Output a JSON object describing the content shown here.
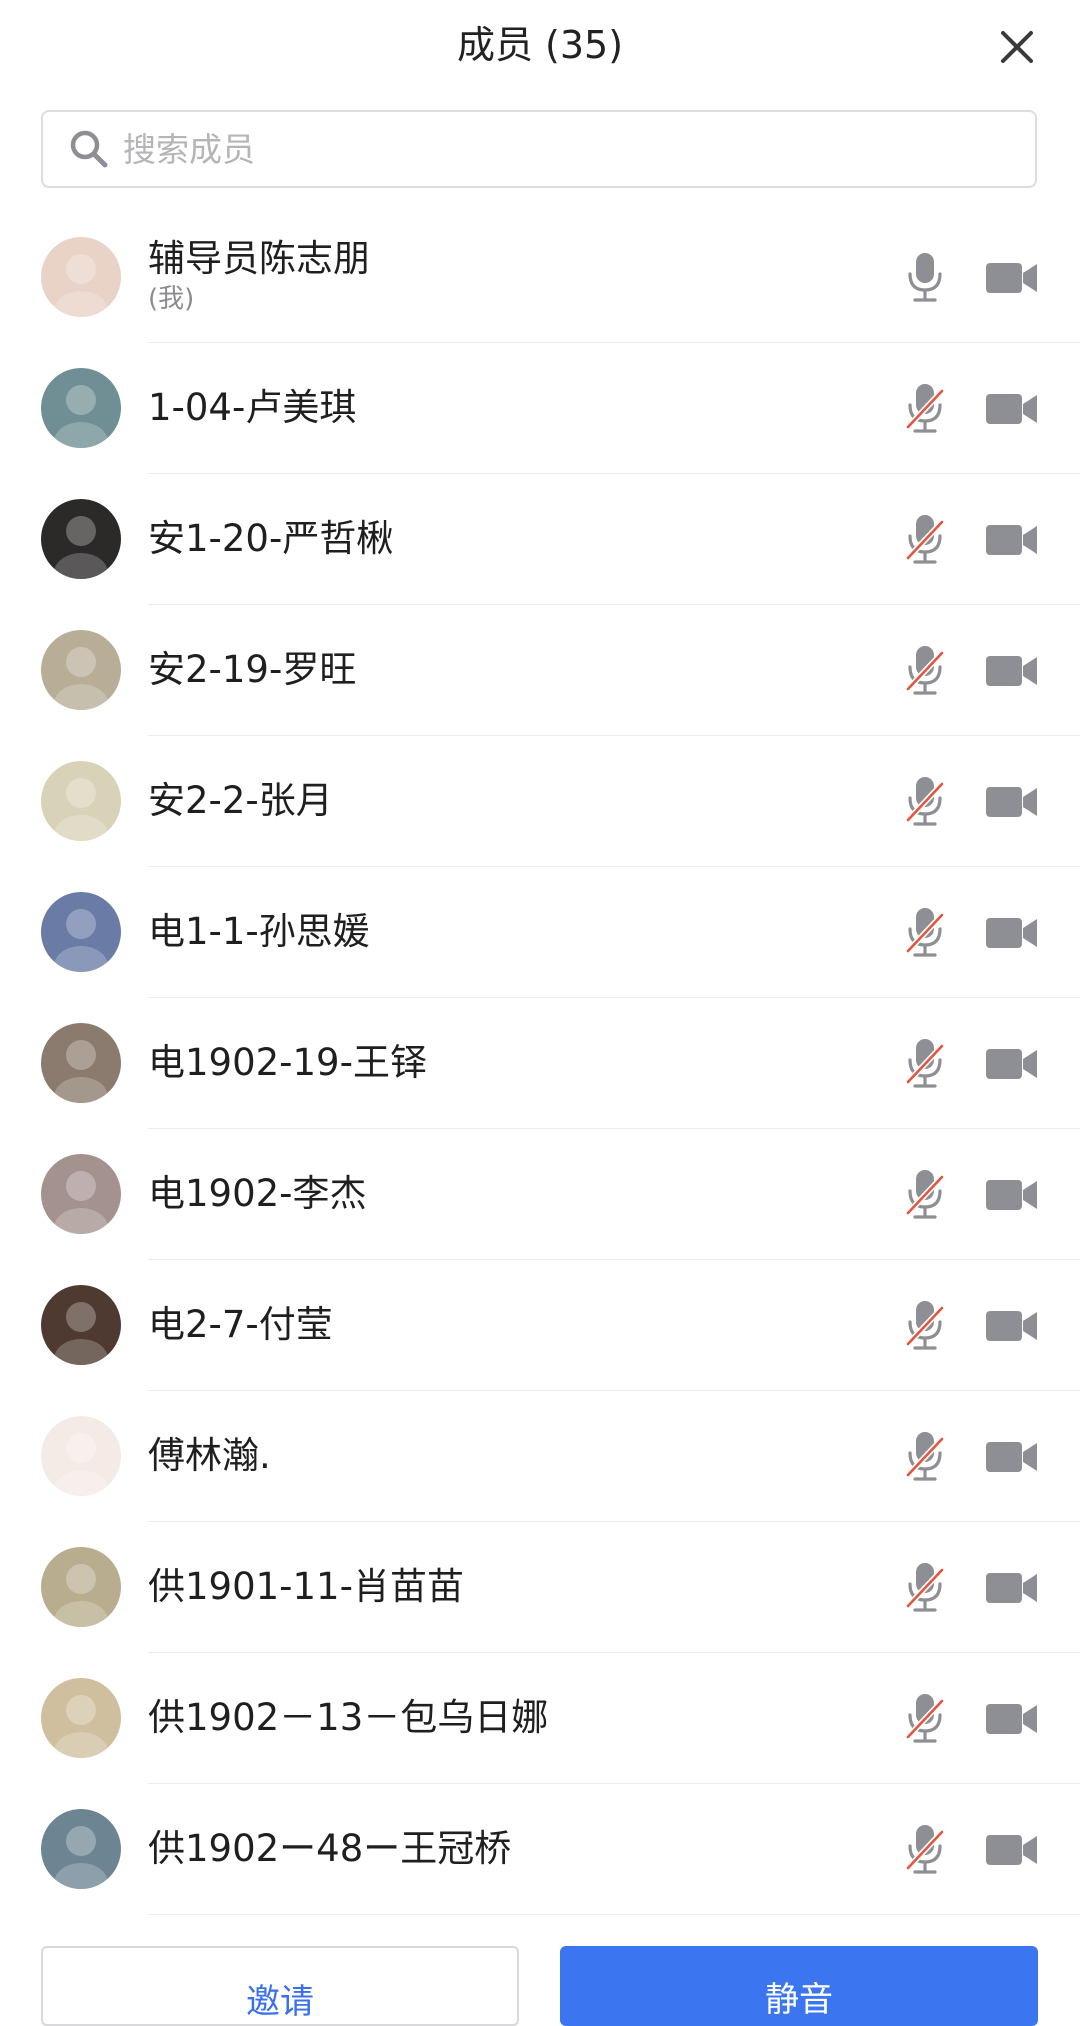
{
  "header": {
    "title": "成员 (35)",
    "close_icon": "close-icon"
  },
  "search": {
    "placeholder": "搜索成员",
    "value": "",
    "icon": "search-icon"
  },
  "colors": {
    "accent": "#3b76f0",
    "muted_slash": "#e4553f",
    "icon_gray": "#8e8f94"
  },
  "members": [
    {
      "name": "辅导员陈志朋",
      "sub": "(我)",
      "mic_muted": false,
      "avatar_bg": "#e9d2c6"
    },
    {
      "name": "1-04-卢美琪",
      "sub": "",
      "mic_muted": true,
      "avatar_bg": "#6f8f94"
    },
    {
      "name": "安1-20-严哲楸",
      "sub": "",
      "mic_muted": true,
      "avatar_bg": "#2c2a29"
    },
    {
      "name": "安2-19-罗旺",
      "sub": "",
      "mic_muted": true,
      "avatar_bg": "#b8ae97"
    },
    {
      "name": "安2-2-张月",
      "sub": "",
      "mic_muted": true,
      "avatar_bg": "#d8d3b8"
    },
    {
      "name": "电1-1-孙思媛",
      "sub": "",
      "mic_muted": true,
      "avatar_bg": "#6a7ba6"
    },
    {
      "name": "电1902-19-王铎",
      "sub": "",
      "mic_muted": true,
      "avatar_bg": "#8b7b6e"
    },
    {
      "name": "电1902-李杰",
      "sub": "",
      "mic_muted": true,
      "avatar_bg": "#a4928f"
    },
    {
      "name": "电2-7-付莹",
      "sub": "",
      "mic_muted": true,
      "avatar_bg": "#4e3a30"
    },
    {
      "name": "傅林瀚.",
      "sub": "",
      "mic_muted": true,
      "avatar_bg": "#f4ebe6"
    },
    {
      "name": "供1901-11-肖苗苗",
      "sub": "",
      "mic_muted": true,
      "avatar_bg": "#b9ad8f"
    },
    {
      "name": "供1902－13－包乌日娜",
      "sub": "",
      "mic_muted": true,
      "avatar_bg": "#cfbf9f"
    },
    {
      "name": "供1902ー48ー王冠桥",
      "sub": "",
      "mic_muted": true,
      "avatar_bg": "#6d8592"
    }
  ],
  "footer": {
    "invite_label": "邀请",
    "mute_all_label": "静音"
  }
}
